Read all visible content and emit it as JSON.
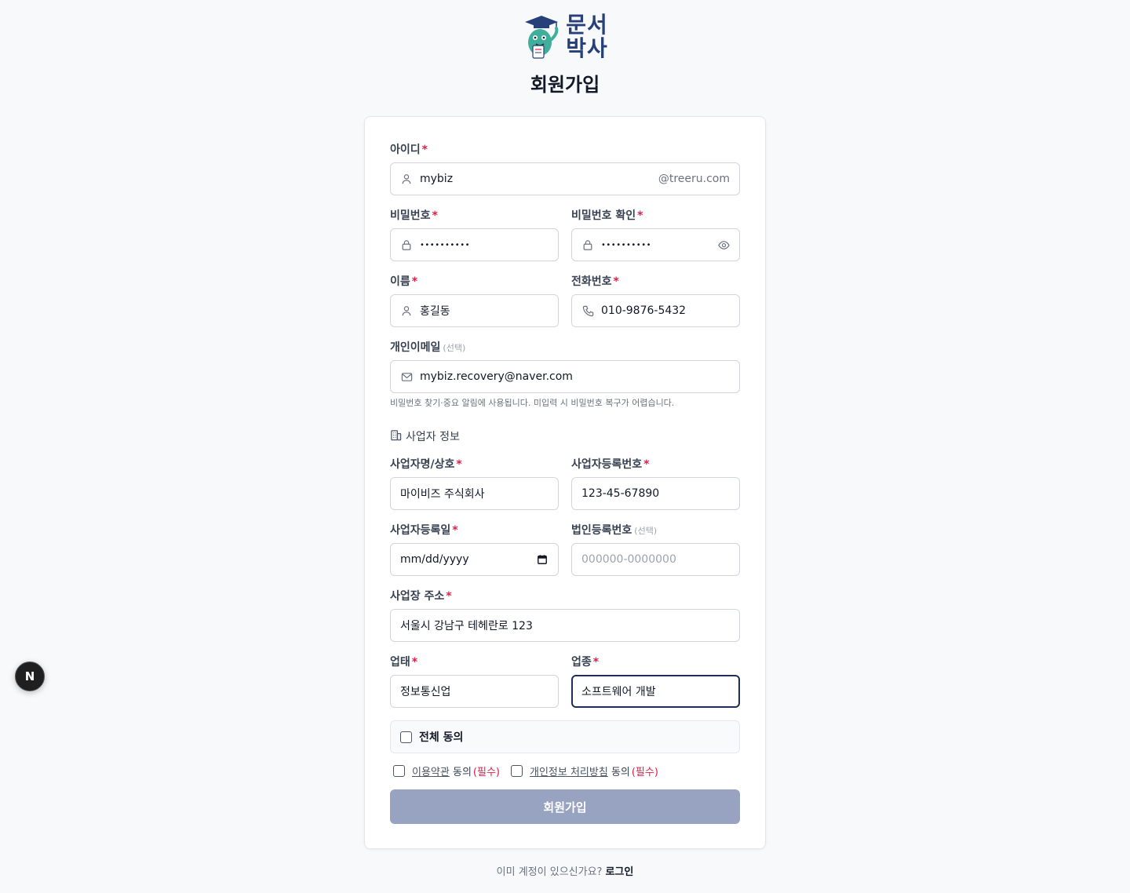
{
  "brand": {
    "line1": "문서",
    "line2": "박사",
    "accent_color": "#27407a",
    "mascot_icon": "graduation-mascot-icon"
  },
  "page_title": "회원가입",
  "form": {
    "required_mark": "*",
    "optional_tag": "(선택)",
    "username": {
      "label": "아이디",
      "value": "mybiz",
      "suffix": "@treeru.com",
      "icon": "user-icon"
    },
    "password": {
      "label": "비밀번호",
      "value": "••••••••••",
      "icon": "lock-icon"
    },
    "password_confirm": {
      "label": "비밀번호 확인",
      "value": "••••••••••",
      "icon": "lock-icon",
      "trail_icon": "eye-icon"
    },
    "name": {
      "label": "이름",
      "value": "홍길동",
      "icon": "user-icon"
    },
    "phone": {
      "label": "전화번호",
      "value": "010-9876-5432",
      "icon": "phone-icon"
    },
    "email": {
      "label": "개인이메일",
      "value": "mybiz.recovery@naver.com",
      "icon": "mail-icon",
      "hint": "비밀번호 찾기·중요 알림에 사용됩니다. 미입력 시 비밀번호 복구가 어렵습니다."
    },
    "business_section_title": "사업자 정보",
    "business_name": {
      "label": "사업자명/상호",
      "value": "마이비즈 주식회사"
    },
    "business_reg_no": {
      "label": "사업자등록번호",
      "value": "123-45-67890"
    },
    "business_reg_date": {
      "label": "사업자등록일",
      "value": "mm/dd/yyyy",
      "icon": "calendar-icon"
    },
    "corp_reg_no": {
      "label": "법인등록번호",
      "placeholder": "000000-0000000"
    },
    "address": {
      "label": "사업장 주소",
      "value": "서울시 강남구 테헤란로 123"
    },
    "business_type": {
      "label": "업태",
      "value": "정보통신업"
    },
    "business_item": {
      "label": "업종",
      "value": "소프트웨어 개발"
    }
  },
  "agreements": {
    "all_label": "전체 동의",
    "terms": {
      "link": "이용약관",
      "text": "동의",
      "tag": "(필수)"
    },
    "privacy": {
      "link": "개인정보 처리방침",
      "text": "동의",
      "tag": "(필수)"
    }
  },
  "submit_label": "회원가입",
  "submit_color": "#98a3c2",
  "footer": {
    "question": "이미 계정이 있으신가요?",
    "login_link": "로그인"
  },
  "dev_badge": "N"
}
